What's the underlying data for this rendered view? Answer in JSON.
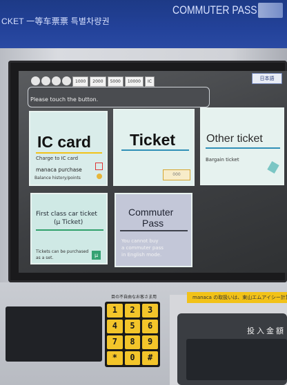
{
  "sign": {
    "left_text": "CKET 一等车票票 특별차량권",
    "right_text": "COMMUTER PASS"
  },
  "screen": {
    "money_pills": [
      "",
      "",
      "",
      "",
      "1000",
      "2000",
      "5000",
      "10000",
      "IC"
    ],
    "language_button": "日本語",
    "prompt": "Please touch the button."
  },
  "buttons": {
    "ic_card": {
      "title": "IC card",
      "line1": "Charge to IC card",
      "line2": "manaca purchase",
      "line3": "Balance history/points"
    },
    "ticket": {
      "title": "Ticket",
      "icon_text": "000"
    },
    "other_ticket": {
      "title": "Other ticket",
      "line1": "Bargain ticket"
    },
    "first_class": {
      "title_line1": "First class car ticket",
      "title_line2": "(μ Ticket)",
      "note_line1": "Tickets can be purchased",
      "note_line2": "as a set."
    },
    "commuter": {
      "title_line1": "Commuter",
      "title_line2": "Pass",
      "note_line1": "You cannot buy",
      "note_line2": "a commuter pass",
      "note_line3": "in English mode."
    }
  },
  "machine": {
    "keypad_label": "目の不自由なお客さま用",
    "keys": [
      "1",
      "2",
      "3",
      "4",
      "5",
      "6",
      "7",
      "8",
      "9",
      "*",
      "0",
      "#"
    ],
    "manaca_strip": "manaca の取扱いは、東山エムアイシー計算所まで",
    "deposit_label": "投入金額"
  },
  "colors": {
    "accent_line_ic": "#f2c218",
    "accent_line_ticket": "#2f8fb6",
    "accent_line_first": "#2fa06a",
    "accent_line_commuter": "#3c3f4a"
  }
}
